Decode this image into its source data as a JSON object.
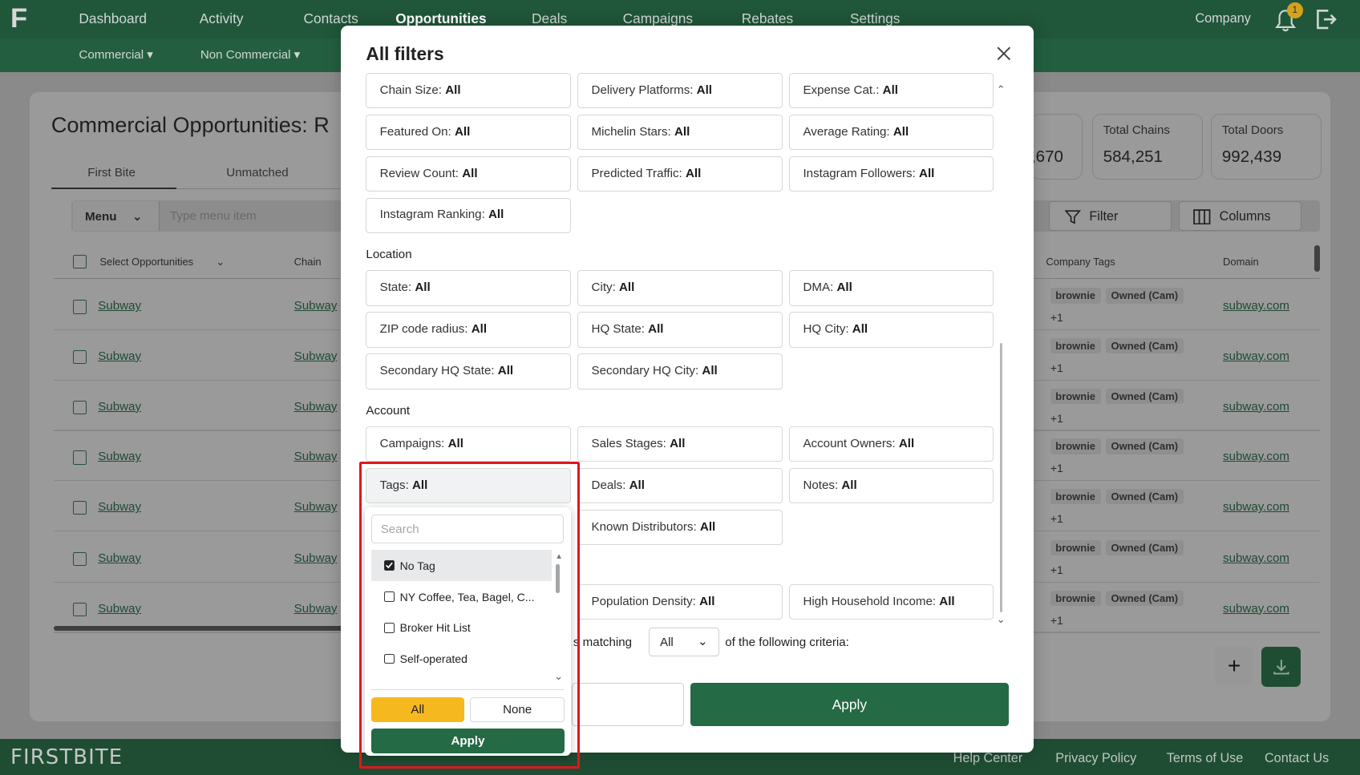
{
  "nav": {
    "items": [
      "Dashboard",
      "Activity",
      "Contacts",
      "Opportunities",
      "Deals",
      "Campaigns",
      "Rebates",
      "Settings"
    ],
    "active": "Opportunities",
    "company": "Company",
    "notification_count": "1",
    "sub_items": [
      "Commercial ▾",
      "Non Commercial ▾"
    ]
  },
  "page": {
    "title": "Commercial Opportunities: R",
    "tabs": [
      "First Bite",
      "Unmatched"
    ],
    "stats": [
      {
        "label": "Total Chains",
        "value": "584,251"
      },
      {
        "label": "Total Doors",
        "value": "992,439"
      }
    ],
    "partial_stat": ",670",
    "menu_select": "Menu",
    "menu_placeholder": "Type menu item",
    "filter_label": "Filter",
    "columns_label": "Columns",
    "headers": {
      "select": "Select Opportunities",
      "chain": "Chain",
      "company_tags": "Company Tags",
      "domain": "Domain"
    },
    "rows": [
      {
        "name": "Subway",
        "chain": "Subway",
        "tags": [
          "brownie",
          "Owned (Cam)"
        ],
        "more": "+1",
        "domain": "subway.com"
      },
      {
        "name": "Subway",
        "chain": "Subway",
        "tags": [
          "brownie",
          "Owned (Cam)"
        ],
        "more": "+1",
        "domain": "subway.com"
      },
      {
        "name": "Subway",
        "chain": "Subway",
        "tags": [
          "brownie",
          "Owned (Cam)"
        ],
        "more": "+1",
        "domain": "subway.com"
      },
      {
        "name": "Subway",
        "chain": "Subway",
        "tags": [
          "brownie",
          "Owned (Cam)"
        ],
        "more": "+1",
        "domain": "subway.com"
      },
      {
        "name": "Subway",
        "chain": "Subway",
        "tags": [
          "brownie",
          "Owned (Cam)"
        ],
        "more": "+1",
        "domain": "subway.com"
      },
      {
        "name": "Subway",
        "chain": "Subway",
        "tags": [
          "brownie",
          "Owned (Cam)"
        ],
        "more": "+1",
        "domain": "subway.com"
      },
      {
        "name": "Subway",
        "chain": "Subway",
        "tags": [
          "brownie",
          "Owned (Cam)"
        ],
        "more": "+1",
        "domain": "subway.com"
      }
    ],
    "add_label": "+"
  },
  "footer": {
    "logo": "FIRSTBITE",
    "links": [
      "Help Center",
      "Privacy Policy",
      "Terms of Use",
      "Contact Us"
    ]
  },
  "modal": {
    "title": "All filters",
    "rows_top": [
      [
        "Chain Size:",
        "Delivery Platforms:",
        "Expense Cat.:"
      ],
      [
        "Featured On:",
        "Michelin Stars:",
        "Average Rating:"
      ],
      [
        "Review Count:",
        "Predicted Traffic:",
        "Instagram Followers:"
      ],
      [
        "Instagram Ranking:"
      ]
    ],
    "all_value": "All",
    "location_label": "Location",
    "location_rows": [
      [
        "State:",
        "City:",
        "DMA:"
      ],
      [
        "ZIP code radius:",
        "HQ State:",
        "HQ City:"
      ],
      [
        "Secondary HQ State:",
        "Secondary HQ City:"
      ]
    ],
    "account_label": "Account",
    "account_rows": [
      [
        "Campaigns:",
        "Sales Stages:",
        "Account Owners:"
      ],
      [
        "Tags:",
        "Deals:",
        "Notes:"
      ],
      [
        "Known Distributors:"
      ]
    ],
    "extra_row": [
      "Population Density:",
      "High Household Income:"
    ],
    "matching_prefix": "s matching",
    "matching_value": "All",
    "matching_suffix": "of the following criteria:",
    "apply_label": "Apply"
  },
  "tags_dropdown": {
    "search_placeholder": "Search",
    "options": [
      {
        "label": "No Tag",
        "checked": true
      },
      {
        "label": "NY Coffee, Tea, Bagel, C...",
        "checked": false
      },
      {
        "label": "Broker Hit List",
        "checked": false
      },
      {
        "label": "Self-operated",
        "checked": false
      }
    ],
    "all_label": "All",
    "none_label": "None",
    "apply_label": "Apply"
  },
  "colors": {
    "brand_green": "#246a45",
    "accent_yellow": "#f6b81f",
    "highlight_red": "#e0161e"
  }
}
